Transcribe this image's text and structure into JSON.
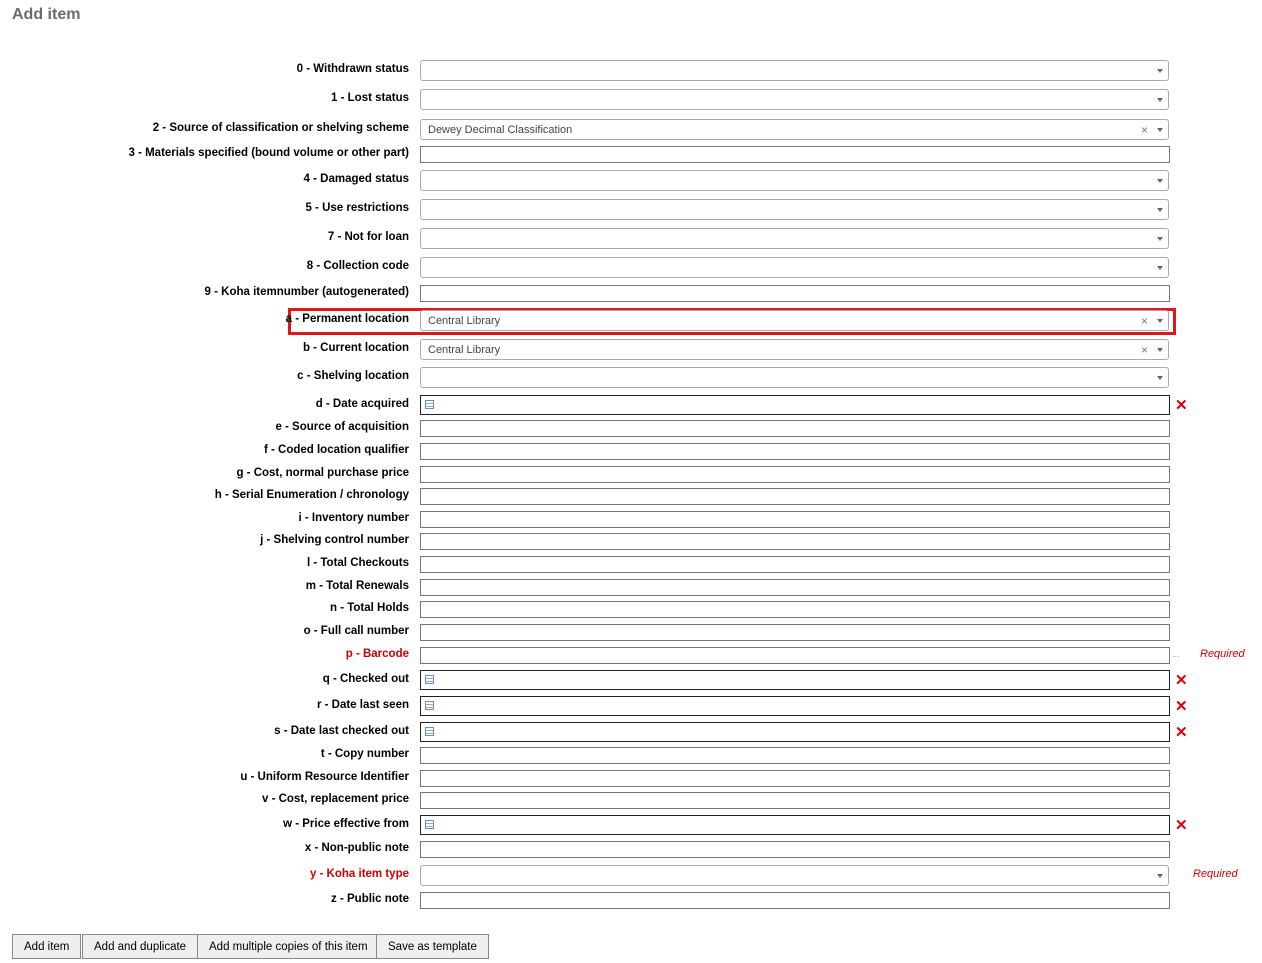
{
  "title": "Add item",
  "fields": [
    {
      "label": "0 - Withdrawn status",
      "type": "select",
      "value": ""
    },
    {
      "label": "1 - Lost status",
      "type": "select",
      "value": ""
    },
    {
      "label": "2 - Source of classification or shelving scheme",
      "type": "select",
      "value": "Dewey Decimal Classification"
    },
    {
      "label": "3 - Materials specified (bound volume or other part)",
      "type": "text",
      "value": ""
    },
    {
      "label": "4 - Damaged status",
      "type": "select",
      "value": ""
    },
    {
      "label": "5 - Use restrictions",
      "type": "select",
      "value": ""
    },
    {
      "label": "7 - Not for loan",
      "type": "select",
      "value": ""
    },
    {
      "label": "8 - Collection code",
      "type": "select",
      "value": ""
    },
    {
      "label": "9 - Koha itemnumber (autogenerated)",
      "type": "text",
      "value": ""
    },
    {
      "label": "a - Permanent location",
      "type": "select",
      "value": "Central Library"
    },
    {
      "label": "b - Current location",
      "type": "select",
      "value": "Central Library"
    },
    {
      "label": "c - Shelving location",
      "type": "select",
      "value": ""
    },
    {
      "label": "d - Date acquired",
      "type": "date",
      "value": ""
    },
    {
      "label": "e - Source of acquisition",
      "type": "text",
      "value": ""
    },
    {
      "label": "f - Coded location qualifier",
      "type": "text",
      "value": ""
    },
    {
      "label": "g - Cost, normal purchase price",
      "type": "text",
      "value": ""
    },
    {
      "label": "h - Serial Enumeration / chronology",
      "type": "text",
      "value": ""
    },
    {
      "label": "i - Inventory number",
      "type": "text",
      "value": ""
    },
    {
      "label": "j - Shelving control number",
      "type": "text",
      "value": ""
    },
    {
      "label": "l - Total Checkouts",
      "type": "text",
      "value": ""
    },
    {
      "label": "m - Total Renewals",
      "type": "text",
      "value": ""
    },
    {
      "label": "n - Total Holds",
      "type": "text",
      "value": ""
    },
    {
      "label": "o - Full call number",
      "type": "text",
      "value": ""
    },
    {
      "label": "p - Barcode",
      "type": "text",
      "value": "",
      "required": true,
      "required_text": "Required",
      "extra": "..."
    },
    {
      "label": "q - Checked out",
      "type": "date",
      "value": ""
    },
    {
      "label": "r - Date last seen",
      "type": "date",
      "value": ""
    },
    {
      "label": "s - Date last checked out",
      "type": "date",
      "value": ""
    },
    {
      "label": "t - Copy number",
      "type": "text",
      "value": ""
    },
    {
      "label": "u - Uniform Resource Identifier",
      "type": "text",
      "value": ""
    },
    {
      "label": "v - Cost, replacement price",
      "type": "text",
      "value": ""
    },
    {
      "label": "w - Price effective from",
      "type": "date",
      "value": ""
    },
    {
      "label": "x - Non-public note",
      "type": "text",
      "value": ""
    },
    {
      "label": "y - Koha item type",
      "type": "select",
      "value": "",
      "required": true,
      "required_text": "Required"
    },
    {
      "label": "z - Public note",
      "type": "text",
      "value": ""
    }
  ],
  "buttons": {
    "add": "Add item",
    "duplicate": "Add and duplicate",
    "multiple": "Add multiple copies of this item",
    "template": "Save as template"
  },
  "clear_glyph": "×",
  "delete_glyph": "✕",
  "highlight_color": "#e0161b"
}
